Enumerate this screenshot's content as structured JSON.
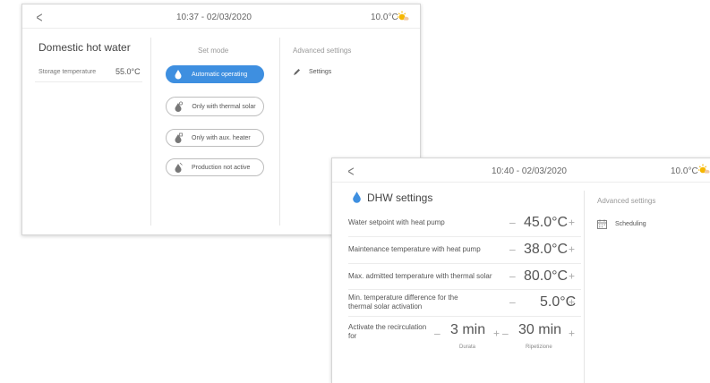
{
  "screen1": {
    "back_icon": "chevron-left-icon",
    "datetime": "10:37 - 02/03/2020",
    "temperature": "10.0°C",
    "section_title": "Domestic hot water",
    "storage_label": "Storage temperature",
    "storage_value": "55.0°C",
    "set_mode_title": "Set mode",
    "modes": [
      {
        "label": "Automatic operating",
        "icon": "water-drop-icon",
        "active": true
      },
      {
        "label": "Only with thermal solar",
        "icon": "solar-drop-icon",
        "active": false
      },
      {
        "label": "Only with aux. heater",
        "icon": "heater-drop-icon",
        "active": false
      },
      {
        "label": "Production not active",
        "icon": "inactive-drop-icon",
        "active": false
      }
    ],
    "advanced_title": "Advanced settings",
    "settings_label": "Settings",
    "settings_icon": "pencil-icon"
  },
  "screen2": {
    "back_icon": "chevron-left-icon",
    "datetime": "10:40 - 02/03/2020",
    "temperature": "10.0°C",
    "title": "DHW settings",
    "title_icon": "water-drop-icon",
    "rows": [
      {
        "label": "Water setpoint with heat pump",
        "value": "45.0°C"
      },
      {
        "label": "Maintenance temperature with heat pump",
        "value": "38.0°C"
      },
      {
        "label": "Max. admitted temperature with thermal solar",
        "value": "80.0°C"
      },
      {
        "label": "Min. temperature difference for the thermal solar activation",
        "value": "5.0°C"
      }
    ],
    "recirculation": {
      "label": "Activate the recirculation for",
      "duration_value": "3 min",
      "duration_caption": "Durata",
      "repeat_value": "30 min",
      "repeat_caption": "Ripetizione"
    },
    "minus_symbol": "–",
    "plus_symbol": "+",
    "advanced_title": "Advanced settings",
    "scheduling_label": "Scheduling",
    "scheduling_icon": "calendar-icon"
  },
  "colors": {
    "accent": "#3e8fe0",
    "sun": "#f5b700"
  }
}
